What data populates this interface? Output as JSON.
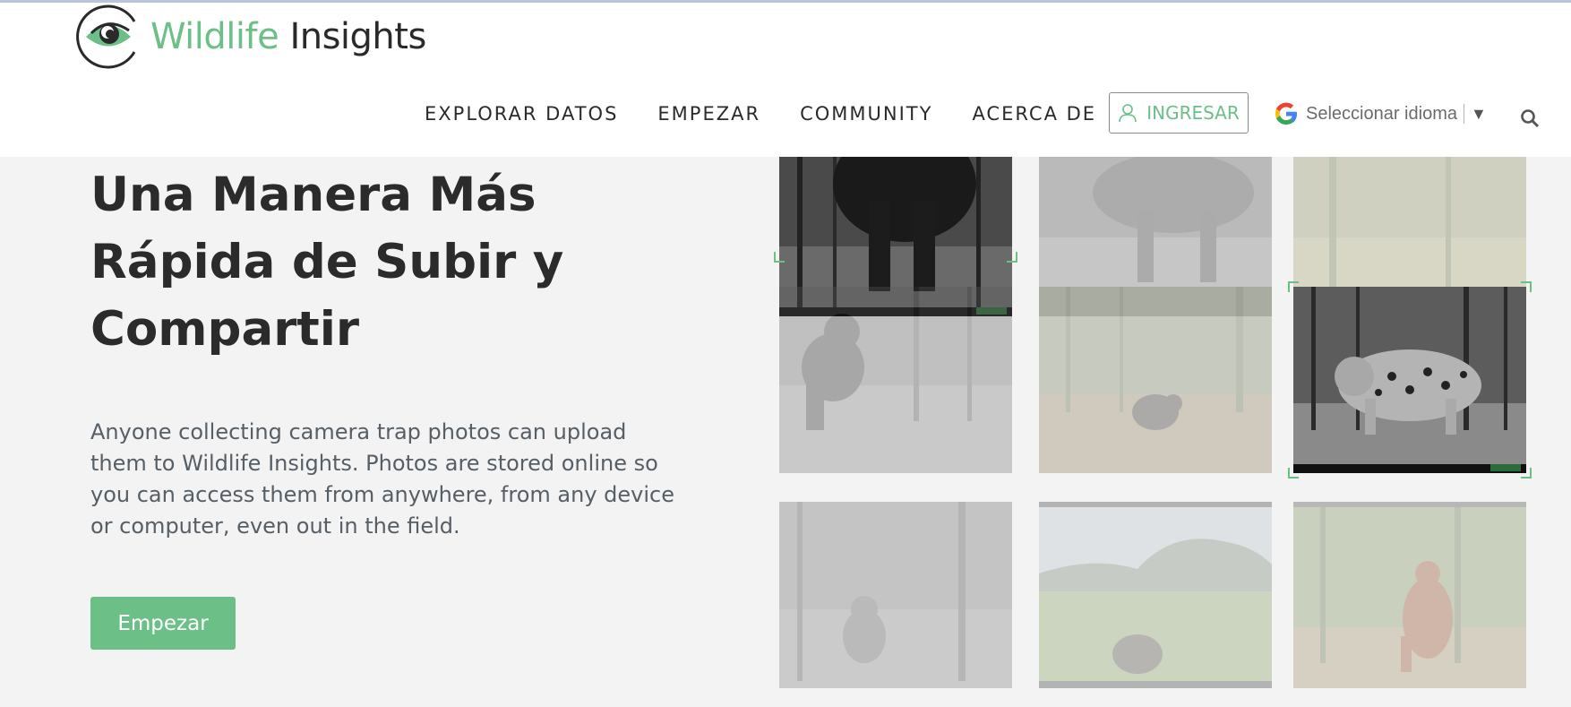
{
  "header": {
    "logo": {
      "word1": "Wildlife",
      "word2": "Insights"
    },
    "nav": [
      {
        "label": "EXPLORAR DATOS"
      },
      {
        "label": "EMPEZAR"
      },
      {
        "label": "COMMUNITY"
      },
      {
        "label": "ACERCA DE"
      }
    ],
    "login_label": "INGRESAR",
    "language": {
      "label": "Seleccionar idioma",
      "arrow": "▼"
    },
    "search_icon": "search-icon"
  },
  "hero": {
    "title": "Una Manera Más Rápida de Subir y Compartir",
    "description": "Anyone collecting camera trap photos can upload them to Wildlife Insights. Photos are stored online so you can access them from anywhere, from any device or computer, even out in the field.",
    "cta_label": "Empezar"
  },
  "gallery": {
    "tiles": [
      {
        "subject": "elephant",
        "highlighted": true
      },
      {
        "subject": "tapir",
        "highlighted": false
      },
      {
        "subject": "forest-floor",
        "highlighted": false
      },
      {
        "subject": "chimpanzee",
        "highlighted": false
      },
      {
        "subject": "small-bear",
        "highlighted": false
      },
      {
        "subject": "jaguar",
        "highlighted": true
      },
      {
        "subject": "monkey",
        "highlighted": false
      },
      {
        "subject": "grassland-armadillo",
        "highlighted": false
      },
      {
        "subject": "orangutan",
        "highlighted": false
      }
    ]
  },
  "colors": {
    "brand_green": "#6cbf87",
    "text_dark": "#2b2b2b",
    "background": "#f3f3f3"
  }
}
